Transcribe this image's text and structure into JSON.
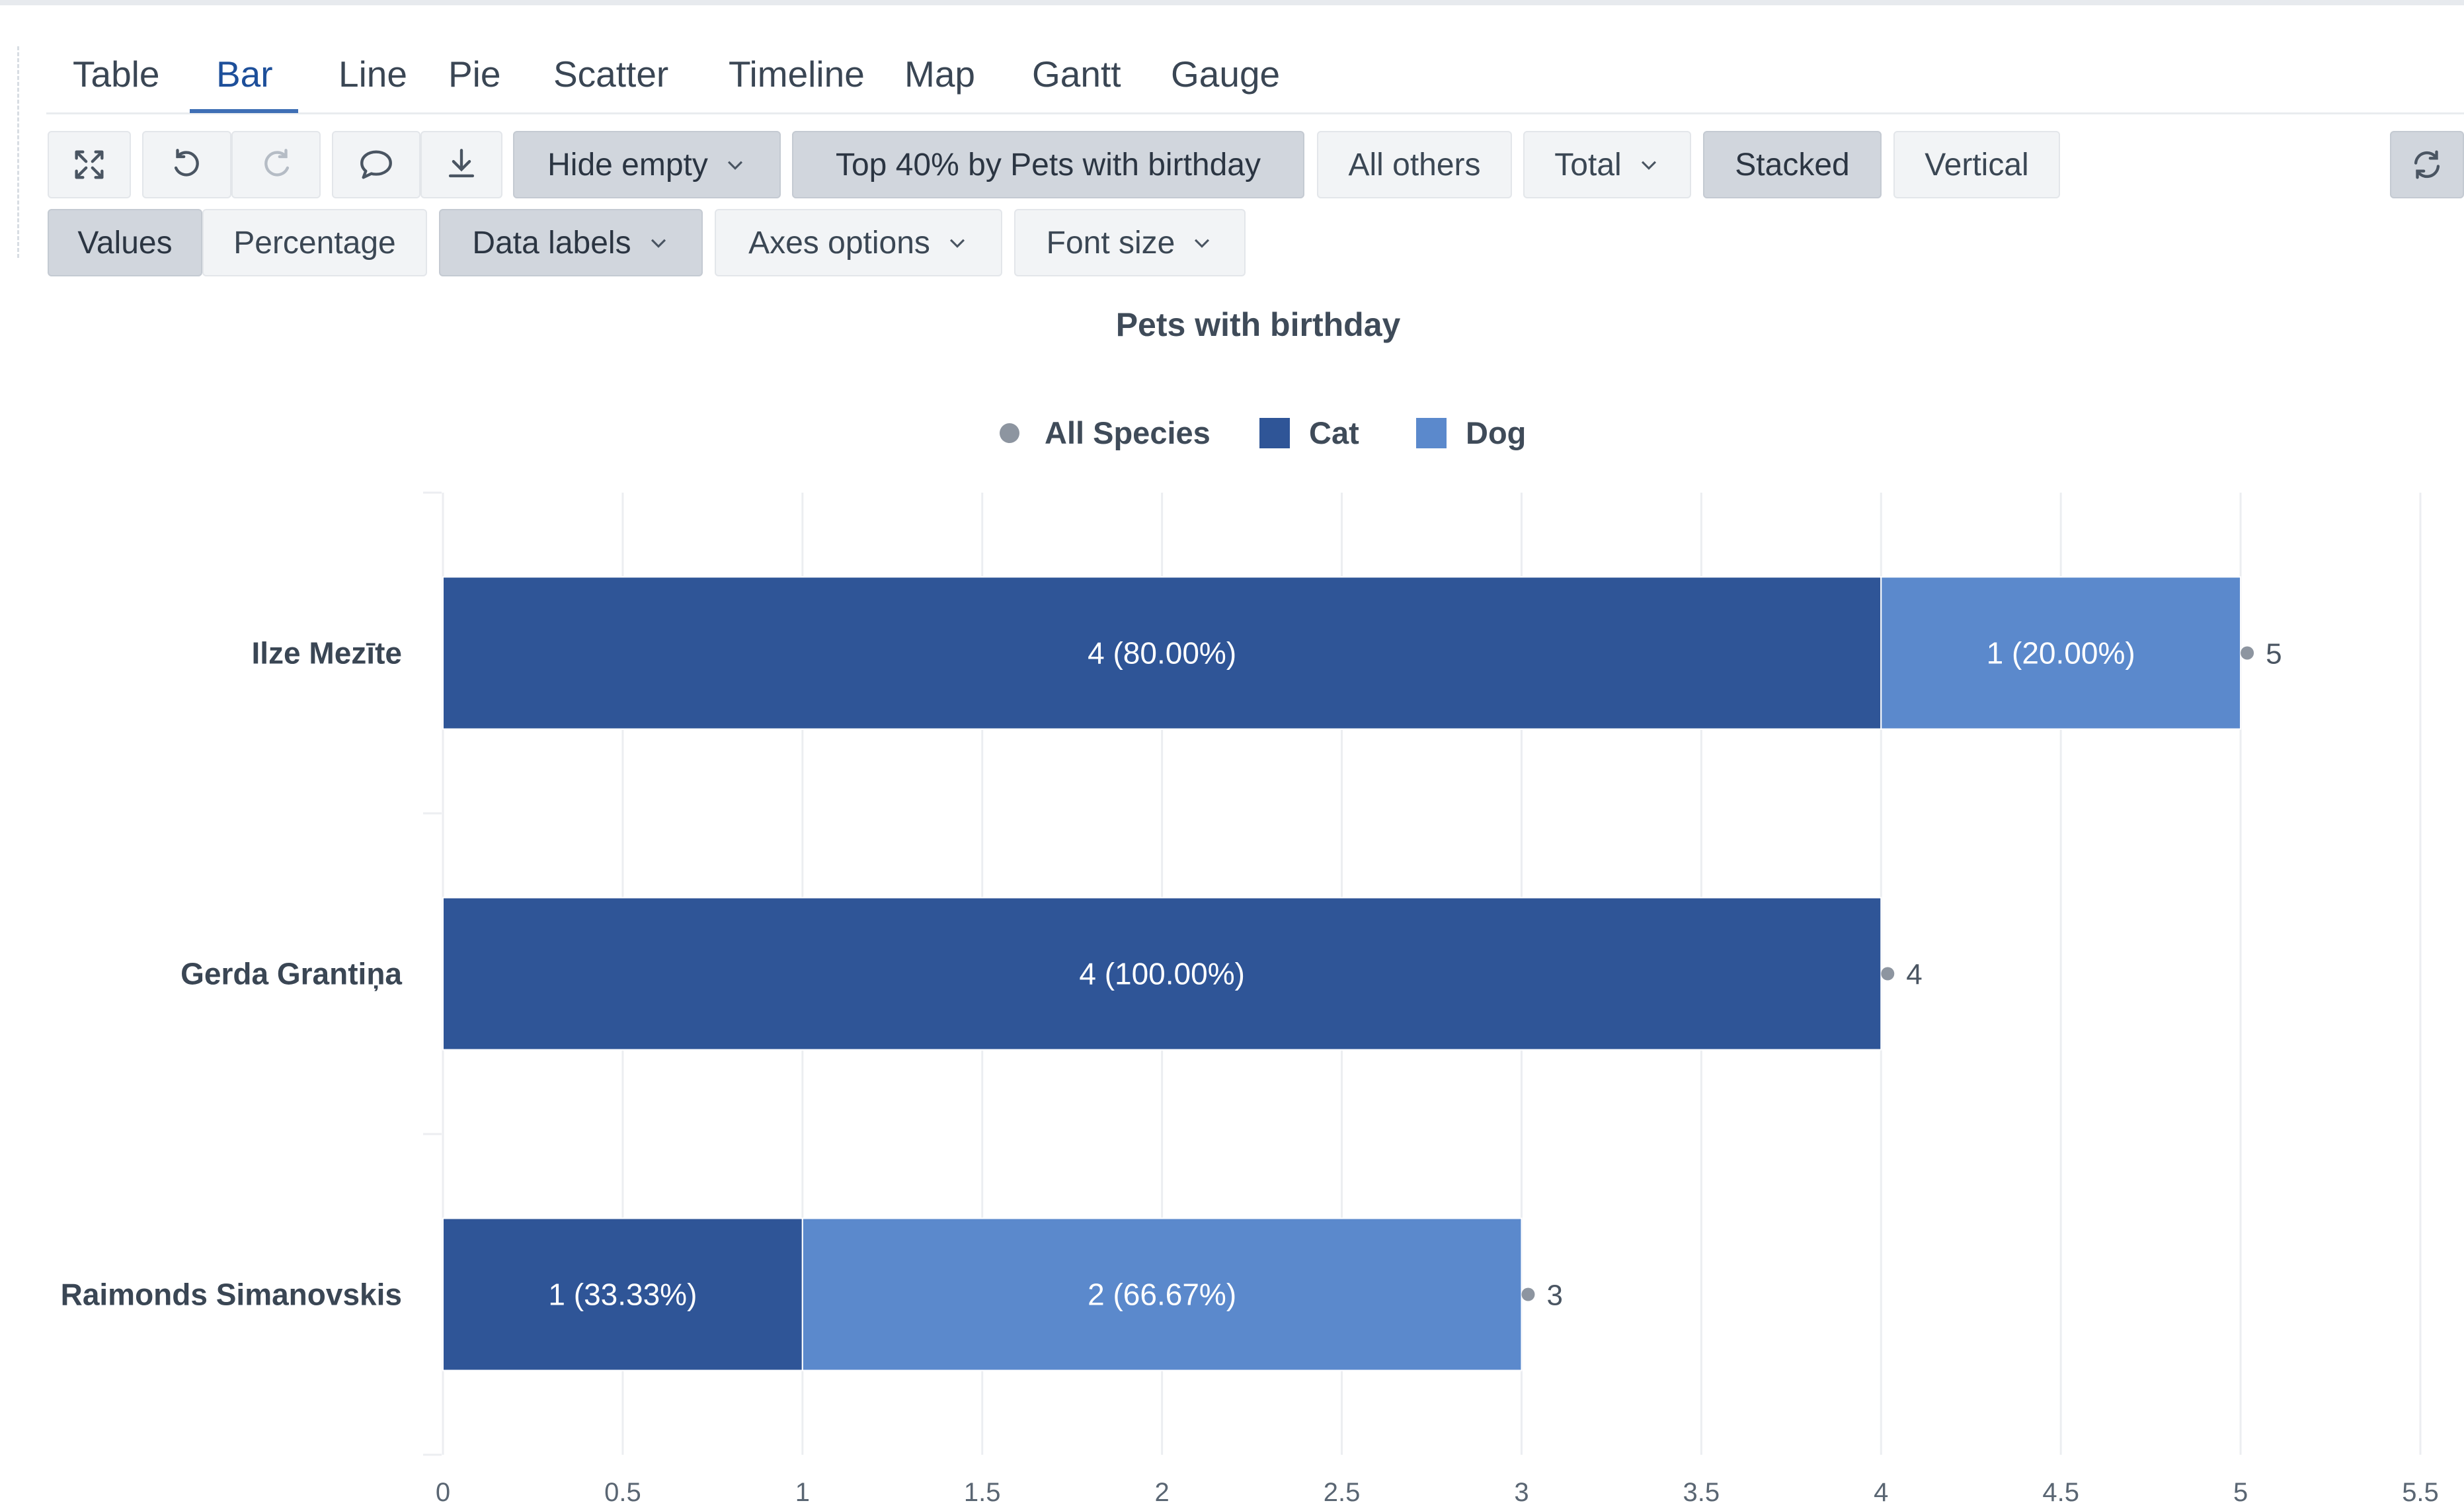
{
  "tabs": [
    {
      "label": "Table",
      "active": false
    },
    {
      "label": "Bar",
      "active": true
    },
    {
      "label": "Line",
      "active": false
    },
    {
      "label": "Pie",
      "active": false
    },
    {
      "label": "Scatter",
      "active": false
    },
    {
      "label": "Timeline",
      "active": false
    },
    {
      "label": "Map",
      "active": false
    },
    {
      "label": "Gantt",
      "active": false
    },
    {
      "label": "Gauge",
      "active": false
    }
  ],
  "toolbar": {
    "icons": [
      "expand-icon",
      "undo-icon",
      "redo-icon",
      "comment-icon",
      "download-icon",
      "refresh-icon"
    ],
    "hide_empty": "Hide empty",
    "top_filter": "Top 40% by Pets with birthday",
    "all_others": "All others",
    "total": "Total",
    "stacked": "Stacked",
    "vertical": "Vertical",
    "values": "Values",
    "percentage": "Percentage",
    "data_labels": "Data labels",
    "axes_options": "Axes options",
    "font_size": "Font size"
  },
  "colors": {
    "cat": "#2f5597",
    "dog": "#5b89cc",
    "all_species": "#8d95a0",
    "accent": "#1d4f9a"
  },
  "chart_data": {
    "type": "bar",
    "orientation": "horizontal",
    "stacked": true,
    "title": "Pets with birthday",
    "legend": [
      "All Species",
      "Cat",
      "Dog"
    ],
    "legend_position": "top-center",
    "categories": [
      "Ilze Mezīte",
      "Gerda Grantiņa",
      "Raimonds Simanovskis"
    ],
    "series": [
      {
        "name": "Cat",
        "values": [
          4,
          4,
          1
        ],
        "labels": [
          "4 (80.00%)",
          "4 (100.00%)",
          "1 (33.33%)"
        ]
      },
      {
        "name": "Dog",
        "values": [
          1,
          0,
          2
        ],
        "labels": [
          "1 (20.00%)",
          "",
          "2 (66.67%)"
        ]
      }
    ],
    "totals": [
      5,
      4,
      3
    ],
    "total_labels": [
      "5",
      "4",
      "3"
    ],
    "xlim": [
      0,
      5.5
    ],
    "xticks": [
      0,
      0.5,
      1,
      1.5,
      2,
      2.5,
      3,
      3.5,
      4,
      4.5,
      5,
      5.5
    ],
    "xtick_labels": [
      "0",
      "0.5",
      "1",
      "1.5",
      "2",
      "2.5",
      "3",
      "3.5",
      "4",
      "4.5",
      "5",
      "5.5"
    ],
    "grid": true
  }
}
